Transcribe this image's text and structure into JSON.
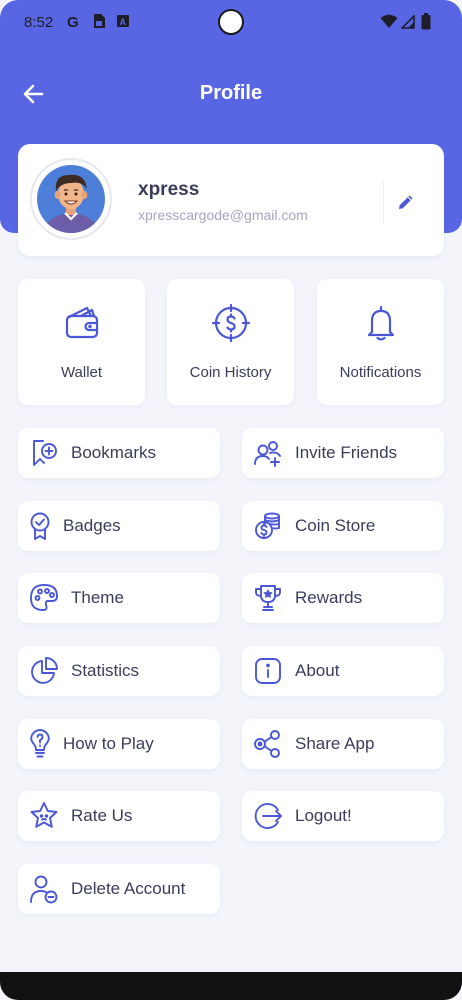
{
  "status_bar": {
    "time": "8:52",
    "left_icons": [
      "google-icon",
      "sim-card-icon",
      "keyboard-a-icon"
    ],
    "right_icons": [
      "wifi-icon",
      "signal-icon",
      "battery-icon"
    ]
  },
  "header": {
    "title": "Profile",
    "background_color": "#5866e4",
    "back_icon": "back-arrow-icon"
  },
  "profile": {
    "name": "xpress",
    "email": "xpresscargode@gmail.com",
    "edit_icon": "pencil-icon"
  },
  "tiles": [
    {
      "label": "Wallet",
      "icon": "wallet-icon"
    },
    {
      "label": "Coin History",
      "icon": "coin-history-icon"
    },
    {
      "label": "Notifications",
      "icon": "bell-icon"
    }
  ],
  "menu": [
    {
      "label": "Bookmarks",
      "icon": "bookmark-icon"
    },
    {
      "label": "Invite Friends",
      "icon": "invite-friends-icon"
    },
    {
      "label": "Badges",
      "icon": "badge-icon"
    },
    {
      "label": "Coin Store",
      "icon": "coin-store-icon"
    },
    {
      "label": "Theme",
      "icon": "palette-icon"
    },
    {
      "label": "Rewards",
      "icon": "trophy-icon"
    },
    {
      "label": "Statistics",
      "icon": "pie-chart-icon"
    },
    {
      "label": "About",
      "icon": "info-icon"
    },
    {
      "label": "How to Play",
      "icon": "lightbulb-icon"
    },
    {
      "label": "Share App",
      "icon": "share-icon"
    },
    {
      "label": "Rate Us",
      "icon": "star-icon"
    },
    {
      "label": "Logout!",
      "icon": "logout-icon"
    },
    {
      "label": "Delete Account",
      "icon": "delete-account-icon"
    }
  ],
  "colors": {
    "accent": "#5866e4",
    "icon": "#4a57d6",
    "text": "#3a3d5a",
    "muted": "#a5a8bb",
    "background": "#f3f5fb"
  }
}
